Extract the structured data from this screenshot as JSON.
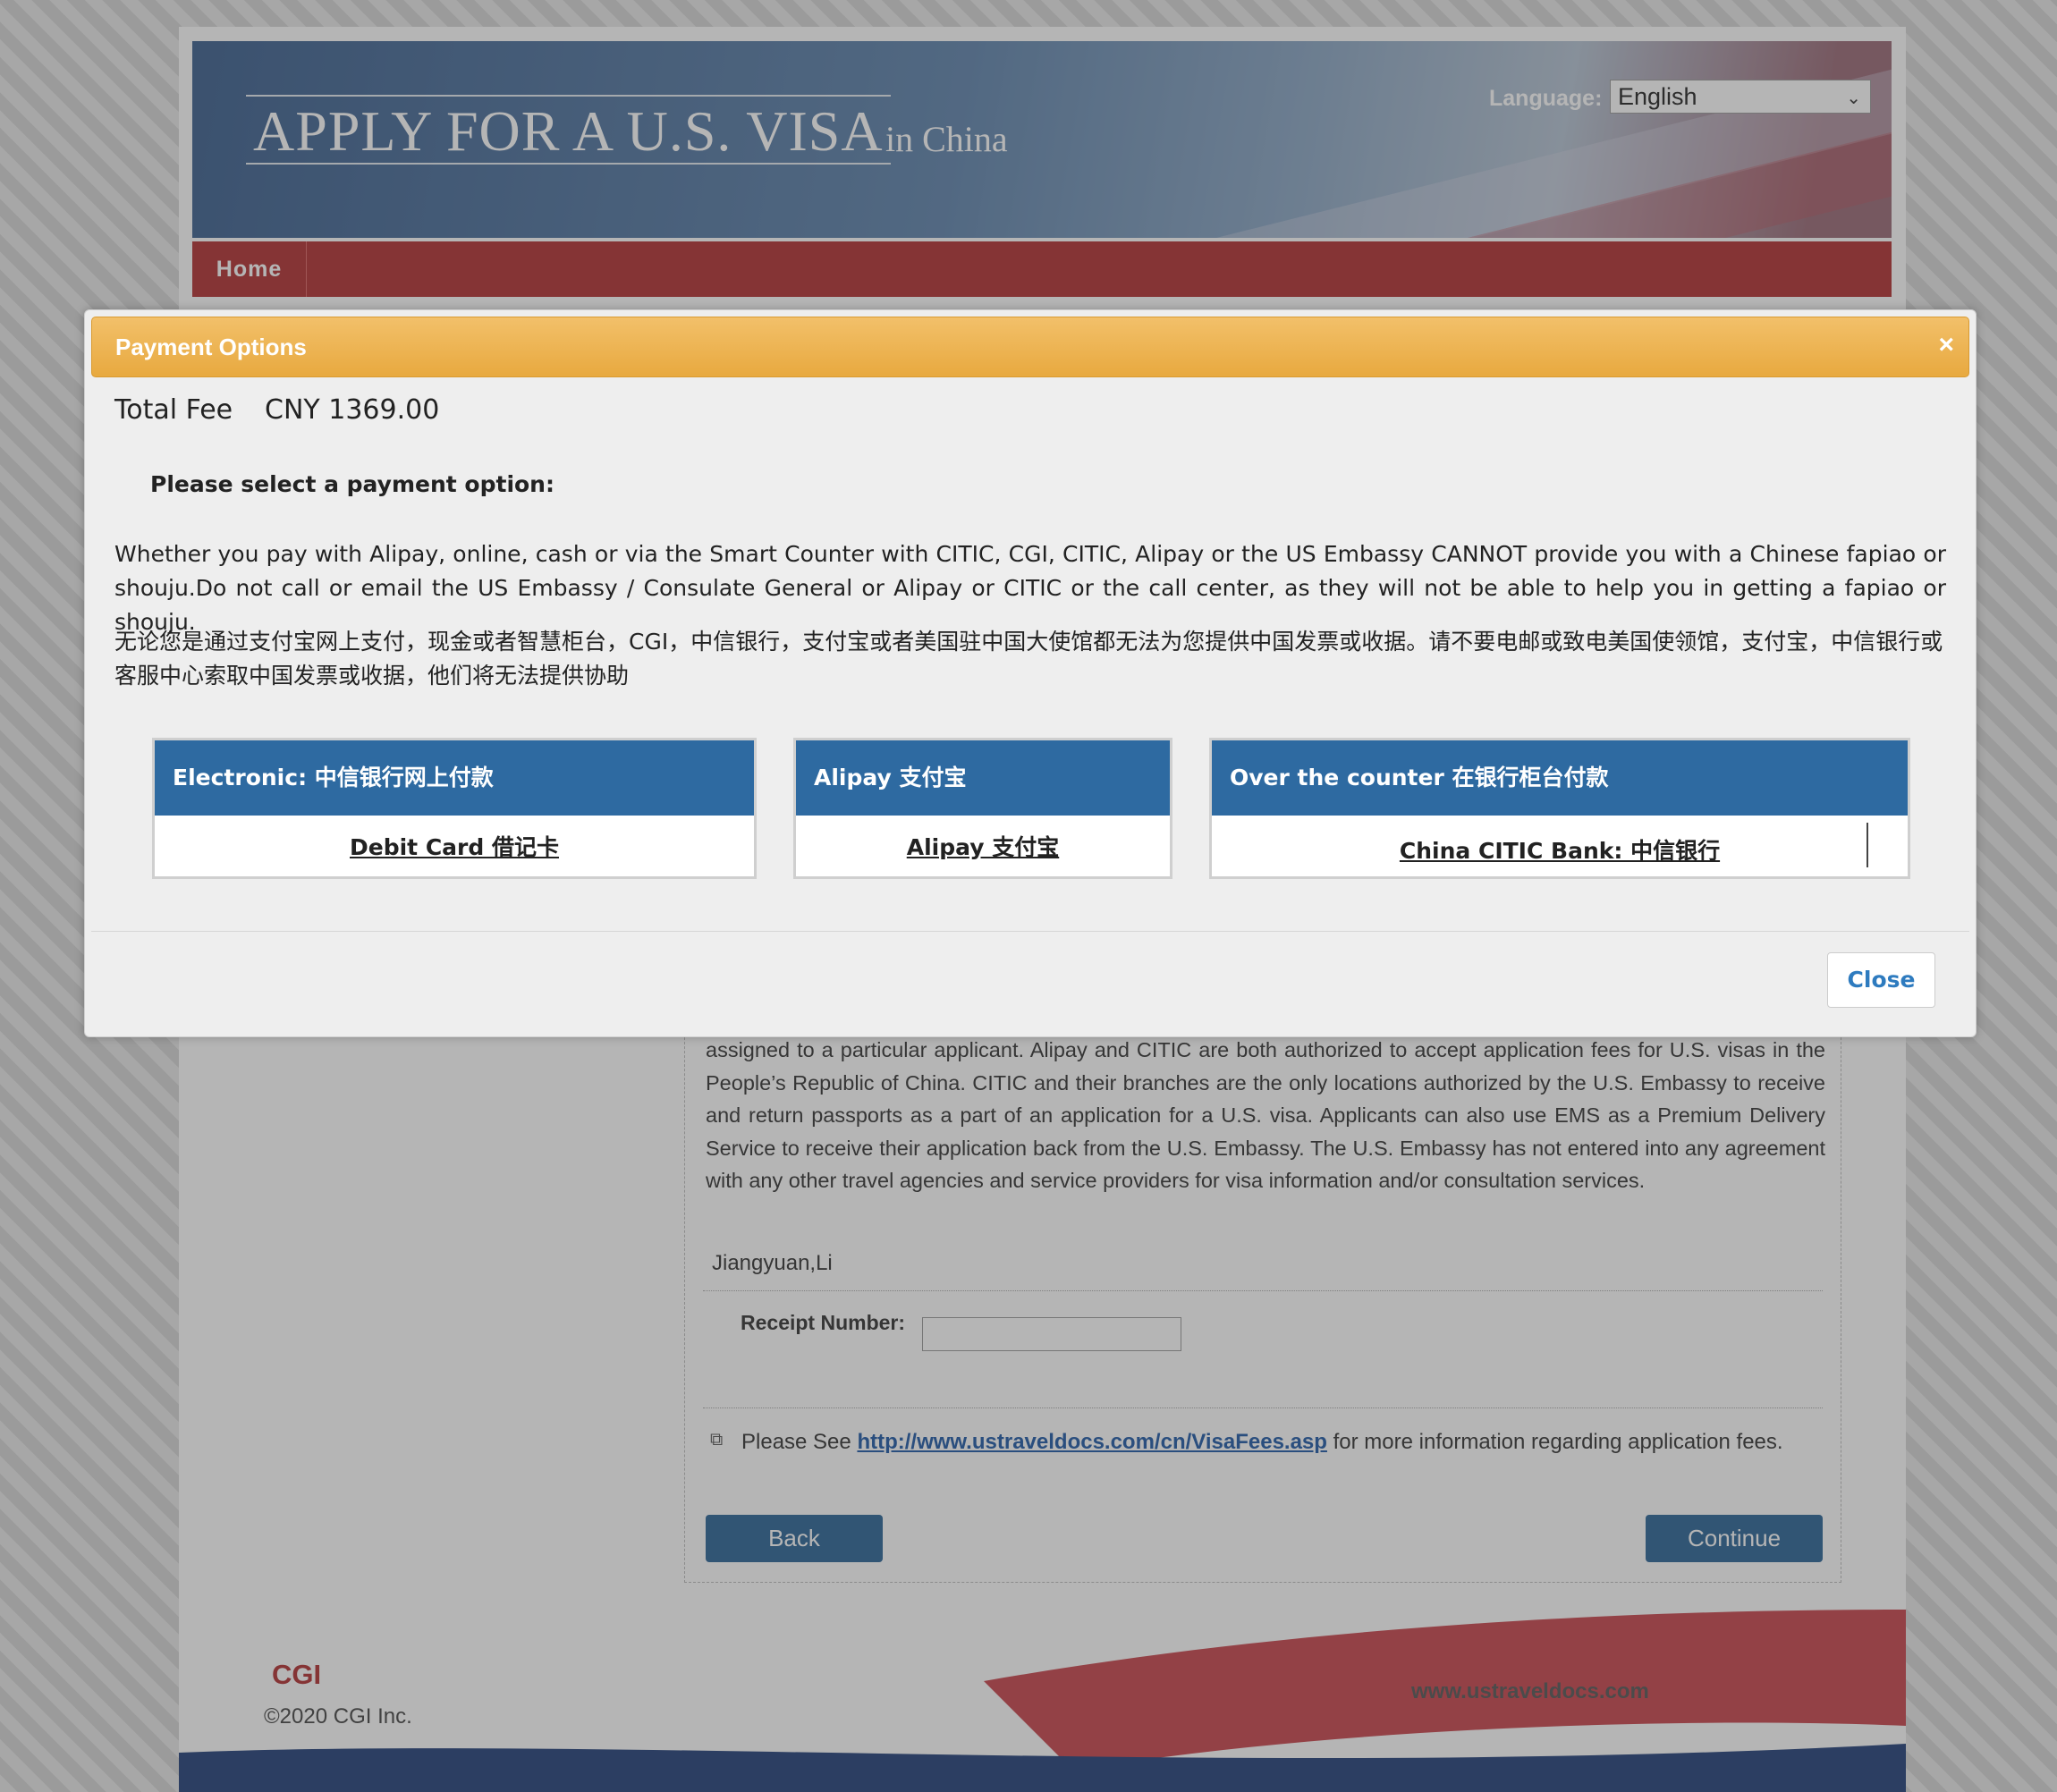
{
  "site": {
    "title": "APPLY FOR A U.S. VISA",
    "subtitle": "in  China",
    "language_label": "Language:",
    "language_value": "English",
    "nav_home": "Home"
  },
  "background_content": {
    "body_text": "assigned to a particular applicant. Alipay and CITIC are both authorized to accept application fees for U.S. visas in the People’s Republic of China. CITIC and their branches are the only locations authorized by the U.S. Embassy to receive and return passports as a part of an application for a U.S. visa. Applicants can also use EMS as a Premium Delivery Service to receive their application back from the U.S. Embassy. The U.S. Embassy has not entered into any agreement with any other travel agencies and service providers for visa information and/or consultation services.",
    "applicant_name": "Jiangyuan,Li",
    "receipt_label": "Receipt Number:",
    "receipt_value": "",
    "see_prefix": "Please See",
    "fees_link": "http://www.ustraveldocs.com/cn/VisaFees.asp",
    "see_suffix": "for more information regarding application fees.",
    "back_label": "Back",
    "continue_label": "Continue"
  },
  "footer": {
    "logo": "CGI",
    "copyright": "©2020 CGI Inc.",
    "url": "www.ustraveldocs.com"
  },
  "modal": {
    "title": "Payment Options",
    "close_x": "×",
    "total_label": "Total Fee",
    "total_value": "CNY 1369.00",
    "select_prompt": "Please select a payment option:",
    "notice_en": "Whether you pay with Alipay, online, cash or via the Smart Counter with CITIC, CGI, CITIC, Alipay or the US Embassy CANNOT provide you with a Chinese fapiao or shouju.Do not call or email the US Embassy / Consulate General or Alipay or CITIC or the call center, as they will not be able to help you in getting a fapiao or shouju.",
    "notice_cn": "无论您是通过支付宝网上支付，现金或者智慧柜台，CGI，中信银行，支付宝或者美国驻中国大使馆都无法为您提供中国发票或收据。请不要电邮或致电美国使领馆，支付宝，中信银行或客服中心索取中国发票或收据，他们将无法提供协助",
    "options": [
      {
        "header": "Electronic: 中信银行网上付款",
        "link": "Debit Card 借记卡"
      },
      {
        "header": "Alipay 支付宝",
        "link": "Alipay 支付宝"
      },
      {
        "header": "Over the counter 在银行柜台付款",
        "link": "China CITIC Bank: 中信银行"
      }
    ],
    "close_button": "Close"
  },
  "colors": {
    "modal_header": "#e8a93f",
    "option_header": "#2e6aa1",
    "nav_bar": "#b22f31",
    "button": "#2a6496"
  }
}
